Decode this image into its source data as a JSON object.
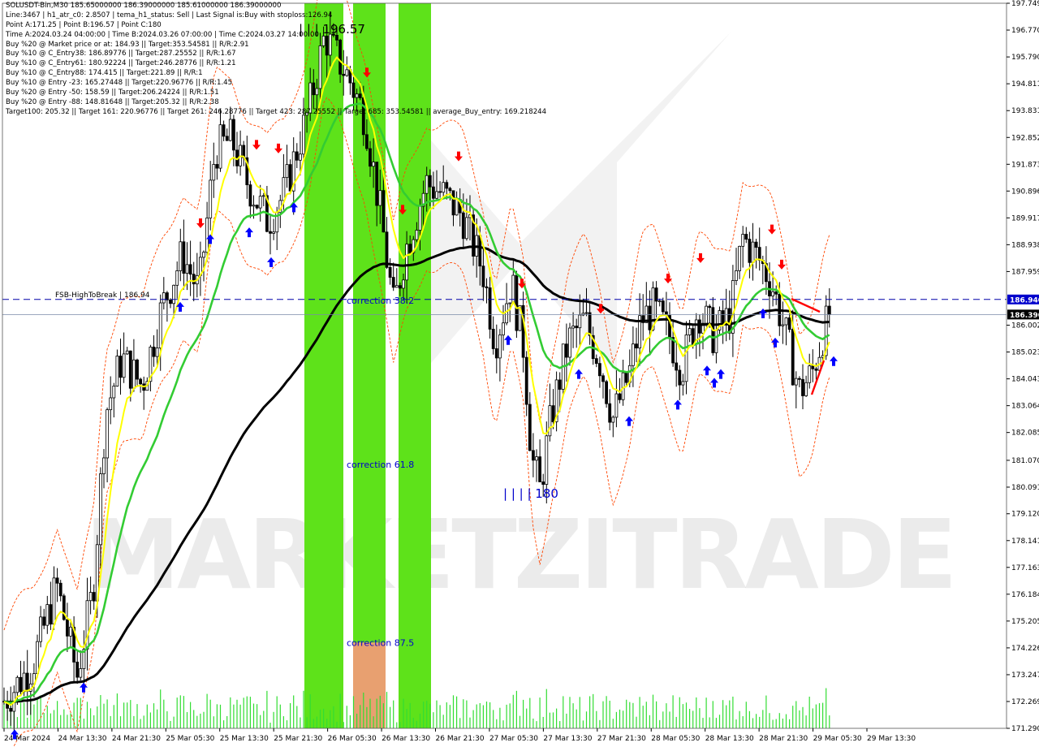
{
  "chart_data": {
    "type": "candlestick",
    "symbol_line": "SOLUSDT-Bin,M30  185.65000000 186.39000000 185.61000000 186.39000000",
    "info_lines": [
      "SOLUSDT-Bin,M30  185.65000000 186.39000000 185.61000000 186.39000000",
      "Line:3467  |  h1_atr_c0: 2.8507  |  tema_h1_status: Sell  |  Last Signal is:Buy with stoploss:126.94",
      "Point A:171.25  |  Point B:196.57  |  Point C:180",
      "Time A:2024.03.24 04:00:00  |  Time B:2024.03.26 07:00:00  |  Time C:2024.03.27 14:00:00",
      "Buy %20 @ Market price or at: 184.93  ||  Target:353.54581  ||  R/R:2.91",
      "Buy %10 @ C_Entry38: 186.89776  ||  Target:287.25552  ||  R/R:1.67",
      "Buy %10 @ C_Entry61: 180.92224  ||  Target:246.28776  ||  R/R:1.21",
      "Buy %10 @ C_Entry88: 174.415  ||  Target:221.89  ||  R/R:1",
      "Buy %10 @ Entry -23: 165.27448  ||  Target:220.96776  ||  R/R:1.45",
      "Buy %20 @ Entry -50: 158.59  ||  Target:206.24224  ||  R/R:1.51",
      "Buy %20 @ Entry -88: 148.81648  ||  Target:205.32  ||  R/R:2.38",
      "Target100: 205.32  ||  Target 161: 220.96776  ||  Target 261: 246.28776  ||  Target 423: 287.25552  ||  Target 685: 353.54581  ||  average_Buy_entry: 169.218244"
    ],
    "y_ticks": [
      "197.749",
      "196.770",
      "195.790",
      "194.811",
      "193.831",
      "192.852",
      "191.873",
      "190.896",
      "189.917",
      "188.938",
      "187.959",
      "186.002",
      "185.023",
      "184.043",
      "183.064",
      "182.085",
      "181.070",
      "180.091",
      "179.120",
      "178.141",
      "177.163",
      "176.184",
      "175.205",
      "174.226",
      "173.247",
      "172.269",
      "171.290"
    ],
    "ylim": [
      171.29,
      197.749
    ],
    "x_ticks": [
      "24 Mar 2024",
      "24 Mar 13:30",
      "24 Mar 21:30",
      "25 Mar 05:30",
      "25 Mar 13:30",
      "25 Mar 21:30",
      "26 Mar 05:30",
      "26 Mar 13:30",
      "26 Mar 21:30",
      "27 Mar 05:30",
      "27 Mar 13:30",
      "27 Mar 21:30",
      "28 Mar 05:30",
      "28 Mar 13:30",
      "28 Mar 21:30",
      "29 Mar 05:30",
      "29 Mar 13:30"
    ],
    "current_price_label": "186.390",
    "current_price": 186.39,
    "break_level_label": "186.940",
    "break_level": 186.94,
    "fsb_label": "FSB-HighToBreak | 186.94",
    "point_labels": [
      {
        "text": "| | | 196.57",
        "value": 196.57
      },
      {
        "text": "| | | | 180",
        "value": 180
      }
    ],
    "corrections": [
      {
        "text": "correction 38.2",
        "value": 186.9
      },
      {
        "text": "correction 61.8",
        "value": 180.92
      },
      {
        "text": "correction 87.5",
        "value": 174.42
      }
    ],
    "watermark": "MARKETZITRADE",
    "colors": {
      "bull": "#000000",
      "bear": "#000000",
      "ema_fast": "#ffff00",
      "ema_mid": "#33cc33",
      "ema_slow": "#000000",
      "envelope": "#ff4500",
      "break_line": "#0000aa",
      "zone_green": "#5ee21a",
      "zone_orange": "#e8a070",
      "arrow_up": "#0000ff",
      "arrow_down": "#ff0000",
      "text_blue": "#0000cc",
      "volume": "#33dd33"
    }
  }
}
